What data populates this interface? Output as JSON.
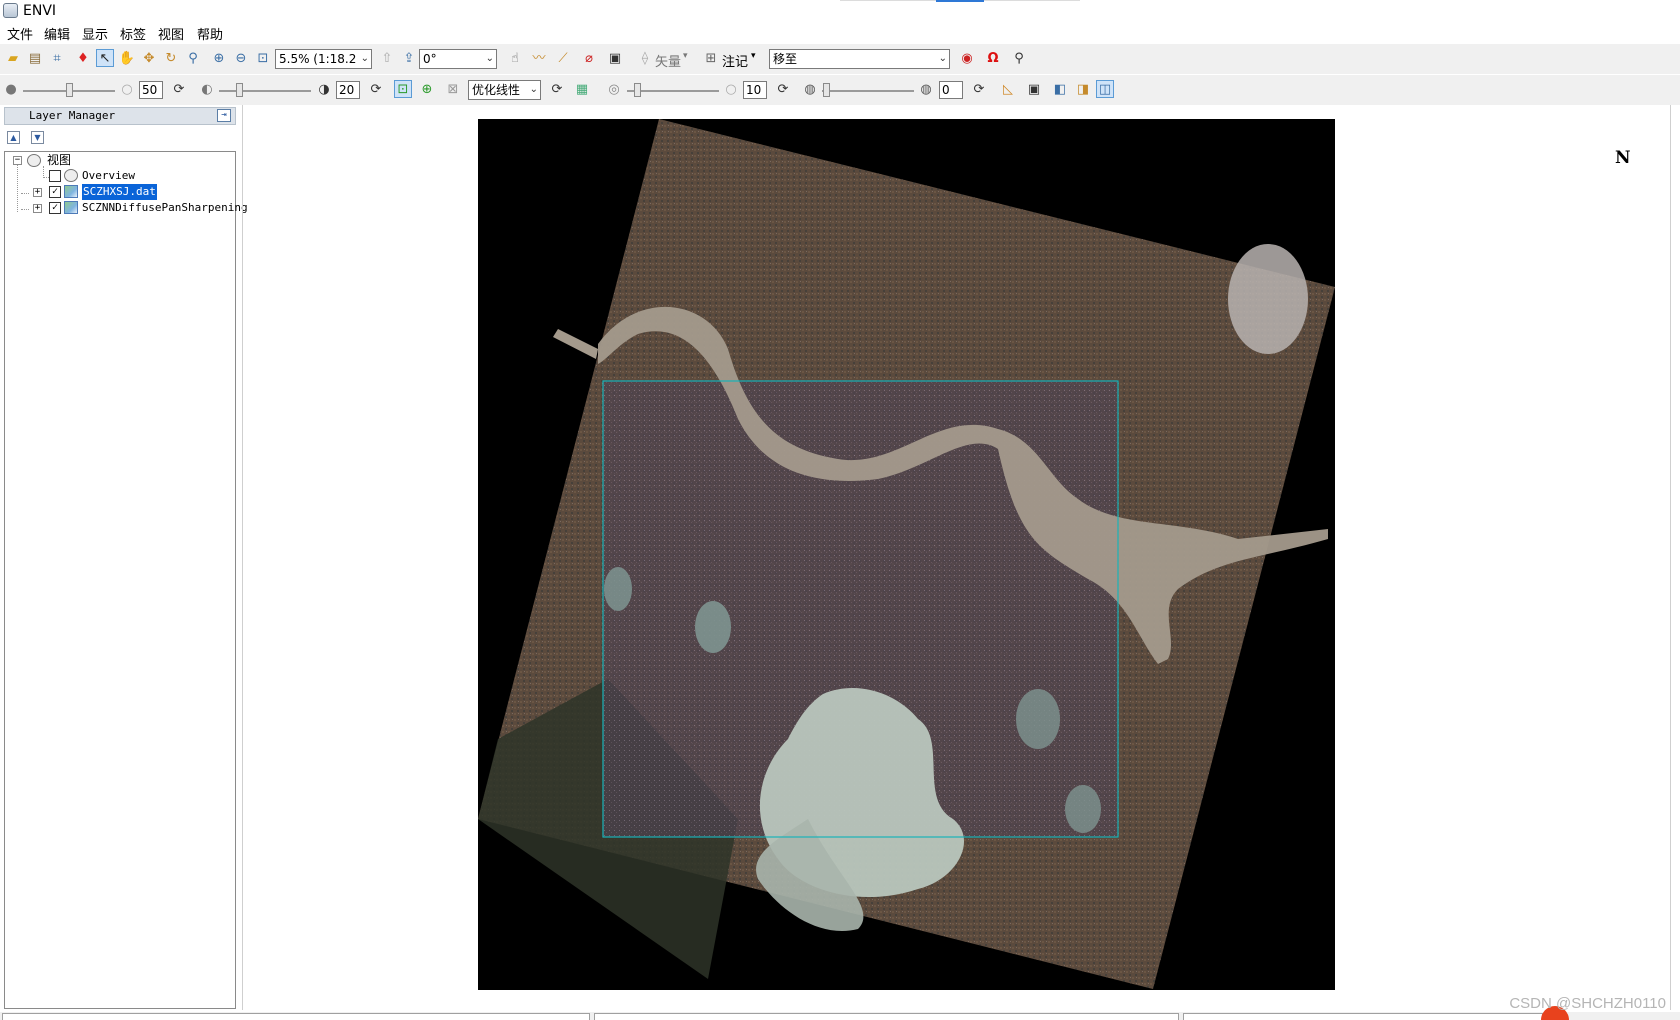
{
  "window": {
    "title": "ENVI"
  },
  "menu": {
    "items": [
      "文件",
      "编辑",
      "显示",
      "标签",
      "视图",
      "帮助"
    ]
  },
  "toolbar1": {
    "zoom": "5.5% (1:18.2",
    "rotation": "0°",
    "vector_label": "矢量",
    "annotation_label": "注记",
    "goto": "移至"
  },
  "toolbar2": {
    "brightness": "50",
    "contrast": "20",
    "stretch": "优化线性",
    "sharpen": "10",
    "transparency": "0"
  },
  "layer_manager": {
    "title": "Layer Manager",
    "tree": {
      "root": "视图",
      "items": [
        {
          "label": "Overview",
          "checked": false,
          "selected": false
        },
        {
          "label": "SCZHXSJ.dat",
          "checked": true,
          "selected": true
        },
        {
          "label": "SCZNNDiffusePanSharpening",
          "checked": true,
          "selected": false
        }
      ]
    }
  },
  "view": {
    "north_arrow": "N"
  },
  "watermark": "CSDN @SHCHZH0110"
}
